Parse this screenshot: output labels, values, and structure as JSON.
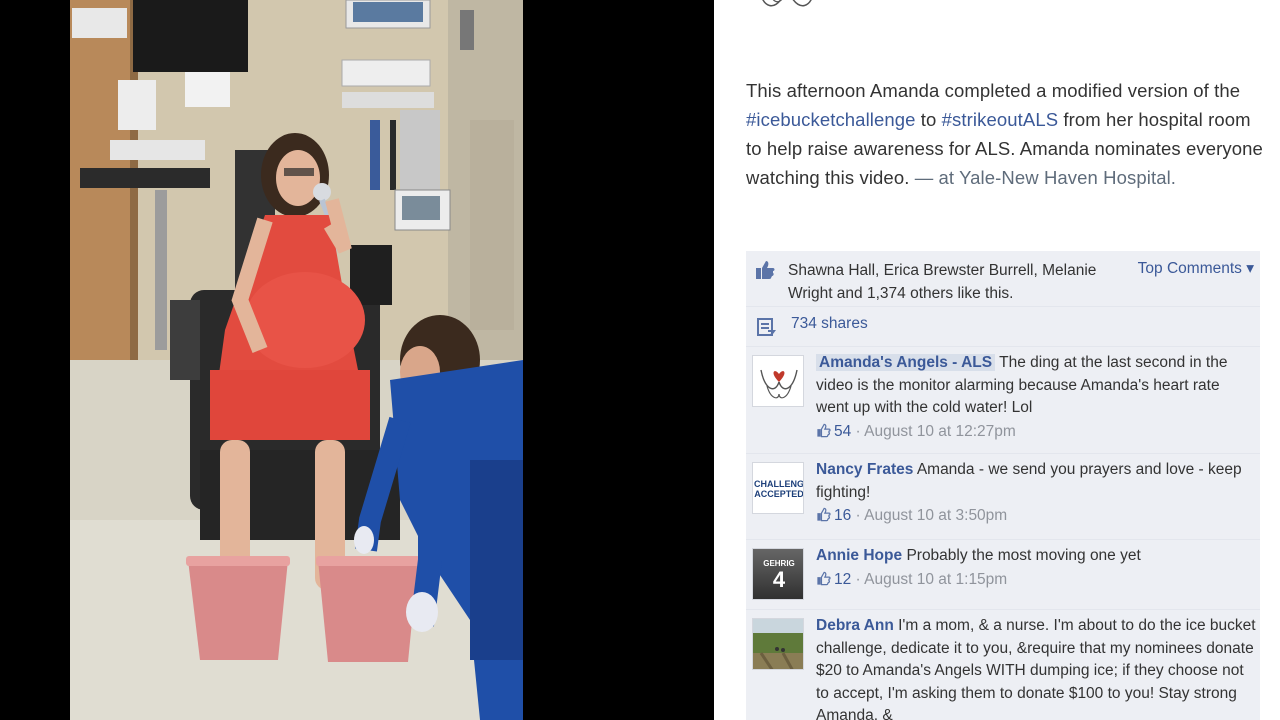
{
  "post": {
    "caption_text": "This afternoon Amanda completed a modified version of the ",
    "hashtag1": "#icebucketchallenge",
    "caption_mid": " to ",
    "hashtag2": "#strikeoutALS",
    "caption_end": " from her hospital room to help raise awareness for ALS. Amanda nominates everyone watching this video.",
    "at_prefix": " — at ",
    "location": "Yale-New Haven Hospital."
  },
  "likes": {
    "text": "Shawna Hall, Erica Brewster Burrell, Melanie Wright and 1,374 others like this.",
    "top_comments": "Top Comments ▾"
  },
  "shares": {
    "text": "734 shares"
  },
  "comments": [
    {
      "author": "Amanda's Angels - ALS",
      "text": "The ding at the last second in the video is the monitor alarming because Amanda's heart rate went up with the cold water! Lol",
      "likes": "54",
      "time": "August 10 at 12:27pm",
      "avatar_icon": "angel-hands-logo-icon"
    },
    {
      "author": "Nancy Frates",
      "text": "Amanda - we send you prayers and love - keep fighting!",
      "likes": "16",
      "time": "August 10 at 3:50pm",
      "avatar_icon": "challenge-accepted-icon"
    },
    {
      "author": "Annie Hope",
      "text": "Probably the most moving one yet",
      "likes": "12",
      "time": "August 10 at 1:15pm",
      "avatar_icon": "jersey-4-icon"
    },
    {
      "author": "Debra Ann",
      "text": "I'm a mom, & a nurse. I'm about to do the ice bucket challenge, dedicate it to you, &require that my nominees donate $20 to Amanda's Angels WITH dumping ice; if they choose not to accept, I'm asking them to donate $100 to you! Stay strong Amanda, &",
      "avatar_icon": "cornfield-photo-icon"
    }
  ],
  "avatar_text": {
    "challenge": "CHALLENG ACCEPTED",
    "jersey_name": "GEHRIG",
    "jersey_number": "4"
  },
  "separator": " · ",
  "colors": {
    "link": "#3b5998",
    "panel": "#edeff4",
    "muted": "#90949c"
  }
}
